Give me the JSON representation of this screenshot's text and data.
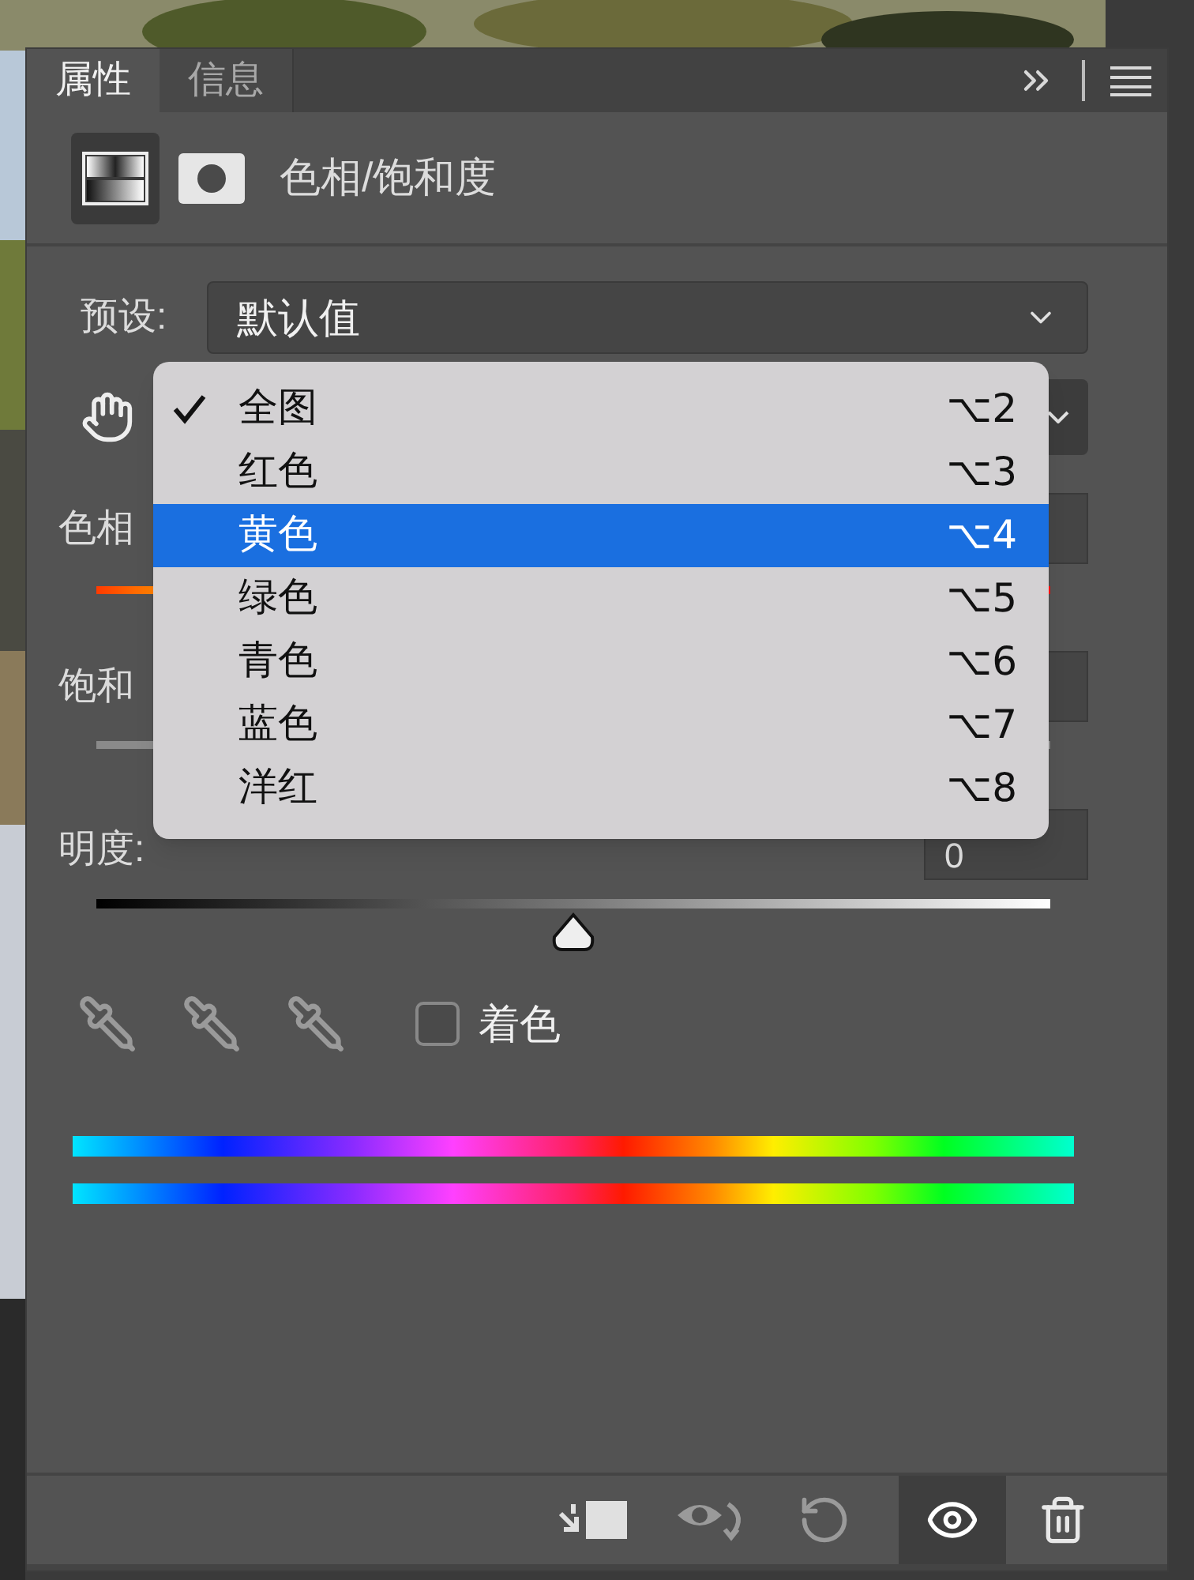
{
  "tabs": [
    {
      "label": "属性",
      "selected": true
    },
    {
      "label": "信息",
      "selected": false
    }
  ],
  "adjustment": {
    "title": "色相/饱和度"
  },
  "preset": {
    "label": "预设:",
    "value": "默认值"
  },
  "hue": {
    "label": "色相"
  },
  "saturation": {
    "label": "饱和"
  },
  "lightness": {
    "label": "明度:",
    "value": "0",
    "level": 0.5
  },
  "colorize": {
    "label": "着色",
    "checked": false
  },
  "channel_menu": {
    "items": [
      {
        "label": "全图",
        "shortcut": "⌥2",
        "checked": true,
        "selected": false
      },
      {
        "label": "红色",
        "shortcut": "⌥3",
        "checked": false,
        "selected": false
      },
      {
        "label": "黄色",
        "shortcut": "⌥4",
        "checked": false,
        "selected": true
      },
      {
        "label": "绿色",
        "shortcut": "⌥5",
        "checked": false,
        "selected": false
      },
      {
        "label": "青色",
        "shortcut": "⌥6",
        "checked": false,
        "selected": false
      },
      {
        "label": "蓝色",
        "shortcut": "⌥7",
        "checked": false,
        "selected": false
      },
      {
        "label": "洋红",
        "shortcut": "⌥8",
        "checked": false,
        "selected": false
      }
    ]
  },
  "footer": {
    "visible": true
  }
}
